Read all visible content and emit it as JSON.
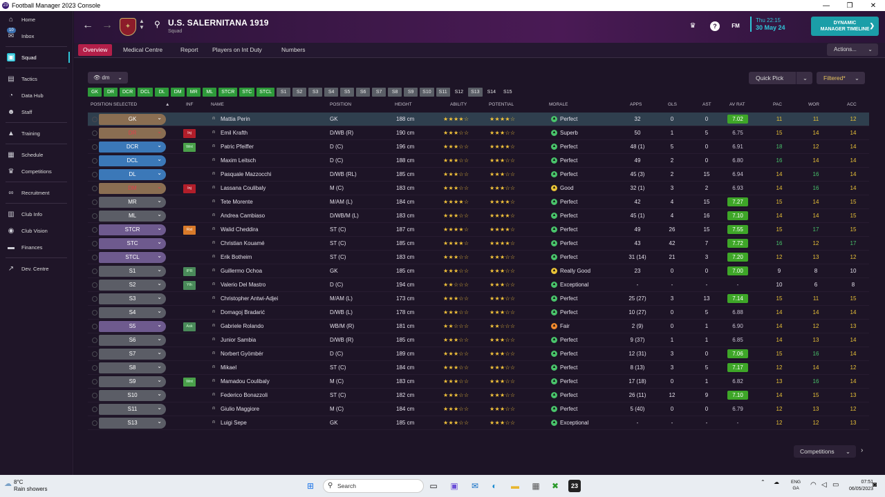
{
  "window": {
    "title": "Football Manager 2023 Console",
    "app_icon": "23"
  },
  "sidebar": {
    "items": [
      {
        "label": "Home",
        "icon": "house-icon",
        "glyph": "⌂"
      },
      {
        "label": "Inbox",
        "icon": "mail-icon",
        "glyph": "✉",
        "badge": "10"
      },
      {
        "label": "Squad",
        "icon": "shirt-icon",
        "glyph": "▣",
        "active": true
      },
      {
        "label": "Tactics",
        "icon": "clipboard-icon",
        "glyph": "▤"
      },
      {
        "label": "Data Hub",
        "icon": "chart-icon",
        "glyph": "◔"
      },
      {
        "label": "Staff",
        "icon": "people-icon",
        "glyph": "☻"
      },
      {
        "label": "Training",
        "icon": "cone-icon",
        "glyph": "▲"
      },
      {
        "label": "Schedule",
        "icon": "calendar-icon",
        "glyph": "▦"
      },
      {
        "label": "Competitions",
        "icon": "trophy-icon",
        "glyph": "♛"
      },
      {
        "label": "Recruitment",
        "icon": "binoculars-icon",
        "glyph": "∞"
      },
      {
        "label": "Club Info",
        "icon": "building-icon",
        "glyph": "▥"
      },
      {
        "label": "Club Vision",
        "icon": "eye-icon",
        "glyph": "◉"
      },
      {
        "label": "Finances",
        "icon": "money-icon",
        "glyph": "▬"
      },
      {
        "label": "Dev. Centre",
        "icon": "growth-icon",
        "glyph": "↗"
      }
    ]
  },
  "header": {
    "club_name": "U.S. SALERNITANA 1919",
    "subtitle": "Squad",
    "date_line1": "Thu 22:15",
    "date_line2": "30 May 24",
    "timeline_line1": "DYNAMIC",
    "timeline_line2": "MANAGER TIMELINE",
    "help": "?",
    "fm": "FM"
  },
  "tabs": [
    {
      "label": "Overview",
      "active": true
    },
    {
      "label": "Medical Centre"
    },
    {
      "label": "Report"
    },
    {
      "label": "Players on Int Duty"
    },
    {
      "label": "Numbers"
    }
  ],
  "toolbar": {
    "actions": "Actions...",
    "view": "dm",
    "quick_pick": "Quick Pick",
    "filtered": "Filtered*"
  },
  "position_chips": [
    {
      "label": "GK",
      "c": "green"
    },
    {
      "label": "DR",
      "c": "green"
    },
    {
      "label": "DCR",
      "c": "green"
    },
    {
      "label": "DCL",
      "c": "green"
    },
    {
      "label": "DL",
      "c": "green"
    },
    {
      "label": "DM",
      "c": "green"
    },
    {
      "label": "MR",
      "c": "green"
    },
    {
      "label": "ML",
      "c": "green"
    },
    {
      "label": "STCR",
      "c": "green"
    },
    {
      "label": "STC",
      "c": "green"
    },
    {
      "label": "STCL",
      "c": "green"
    },
    {
      "label": "S1",
      "c": "grey"
    },
    {
      "label": "S2",
      "c": "grey"
    },
    {
      "label": "S3",
      "c": "grey"
    },
    {
      "label": "S4",
      "c": "grey"
    },
    {
      "label": "S5",
      "c": "grey"
    },
    {
      "label": "S6",
      "c": "grey"
    },
    {
      "label": "S7",
      "c": "grey"
    },
    {
      "label": "S8",
      "c": "grey"
    },
    {
      "label": "S9",
      "c": "grey"
    },
    {
      "label": "S10",
      "c": "grey"
    },
    {
      "label": "S11",
      "c": "grey"
    },
    {
      "label": "S12",
      "c": "plain"
    },
    {
      "label": "S13",
      "c": "grey"
    },
    {
      "label": "S14",
      "c": "plain"
    },
    {
      "label": "S15",
      "c": "plain"
    }
  ],
  "columns": {
    "position_selected": "POSITION SELECTED",
    "inf": "INF",
    "name": "NAME",
    "position": "POSITION",
    "height": "HEIGHT",
    "ability": "ABILITY",
    "potential": "POTENTIAL",
    "morale": "MORALE",
    "apps": "APPS",
    "gls": "GLS",
    "ast": "AST",
    "avrat": "AV RAT",
    "pac": "PAC",
    "wor": "WOR",
    "acc": "ACC"
  },
  "players": [
    {
      "slot": "GK",
      "pc": "k",
      "inf": "",
      "name": "Mattia Perin",
      "position": "GK",
      "height": "188 cm",
      "ability": "★★★★☆",
      "potential": "★★★★☆",
      "morale": "Perfect",
      "mc": "gr",
      "apps": "32",
      "gls": "0",
      "ast": "0",
      "avrat": "7.02",
      "hi": true,
      "pac": "11",
      "wor": "11",
      "acc": "12",
      "pacc": "y",
      "worc": "y",
      "accc": "y"
    },
    {
      "slot": "DR",
      "pc": "k",
      "red": true,
      "inf": "Inj",
      "ic": "inj",
      "name": "Emil Krafth",
      "position": "D/WB (R)",
      "height": "190 cm",
      "ability": "★★★☆☆",
      "potential": "★★★☆☆",
      "morale": "Superb",
      "mc": "gr",
      "apps": "50",
      "gls": "1",
      "ast": "5",
      "avrat": "6.75",
      "hi": false,
      "pac": "15",
      "wor": "14",
      "acc": "14",
      "pacc": "y",
      "worc": "y",
      "accc": "y"
    },
    {
      "slot": "DCR",
      "pc": "b",
      "inf": "Wnt",
      "ic": "wnt",
      "name": "Patric Pfeiffer",
      "position": "D (C)",
      "height": "196 cm",
      "ability": "★★★☆☆",
      "potential": "★★★★☆",
      "morale": "Perfect",
      "mc": "gr",
      "apps": "48 (1)",
      "gls": "5",
      "ast": "0",
      "avrat": "6.91",
      "hi": false,
      "pac": "18",
      "wor": "12",
      "acc": "14",
      "pacc": "g",
      "worc": "y",
      "accc": "y"
    },
    {
      "slot": "DCL",
      "pc": "b",
      "inf": "",
      "name": "Maxim Leitsch",
      "position": "D (C)",
      "height": "188 cm",
      "ability": "★★★☆☆",
      "potential": "★★★☆☆",
      "morale": "Perfect",
      "mc": "gr",
      "apps": "49",
      "gls": "2",
      "ast": "0",
      "avrat": "6.80",
      "hi": false,
      "pac": "16",
      "wor": "14",
      "acc": "14",
      "pacc": "g",
      "worc": "y",
      "accc": "y"
    },
    {
      "slot": "DL",
      "pc": "b",
      "inf": "",
      "name": "Pasquale Mazzocchi",
      "position": "D/WB (RL)",
      "height": "185 cm",
      "ability": "★★★☆☆",
      "potential": "★★★☆☆",
      "morale": "Perfect",
      "mc": "gr",
      "apps": "45 (3)",
      "gls": "2",
      "ast": "15",
      "avrat": "6.94",
      "hi": false,
      "pac": "14",
      "wor": "16",
      "acc": "14",
      "pacc": "y",
      "worc": "g",
      "accc": "y"
    },
    {
      "slot": "DM",
      "pc": "k",
      "red": true,
      "inf": "Inj",
      "ic": "inj",
      "name": "Lassana Coulibaly",
      "position": "M (C)",
      "height": "183 cm",
      "ability": "★★★☆☆",
      "potential": "★★★☆☆",
      "morale": "Good",
      "mc": "ye",
      "apps": "32 (1)",
      "gls": "3",
      "ast": "2",
      "avrat": "6.93",
      "hi": false,
      "pac": "14",
      "wor": "16",
      "acc": "14",
      "pacc": "y",
      "worc": "g",
      "accc": "y"
    },
    {
      "slot": "MR",
      "pc": "g",
      "inf": "",
      "name": "Tete Morente",
      "position": "M/AM (L)",
      "height": "184 cm",
      "ability": "★★★★☆",
      "potential": "★★★★☆",
      "morale": "Perfect",
      "mc": "gr",
      "apps": "42",
      "gls": "4",
      "ast": "15",
      "avrat": "7.27",
      "hi": true,
      "pac": "15",
      "wor": "14",
      "acc": "15",
      "pacc": "y",
      "worc": "y",
      "accc": "y"
    },
    {
      "slot": "ML",
      "pc": "g",
      "inf": "",
      "name": "Andrea Cambiaso",
      "position": "D/WB/M (L)",
      "height": "183 cm",
      "ability": "★★★☆☆",
      "potential": "★★★★☆",
      "morale": "Perfect",
      "mc": "gr",
      "apps": "45 (1)",
      "gls": "4",
      "ast": "16",
      "avrat": "7.10",
      "hi": true,
      "pac": "14",
      "wor": "14",
      "acc": "15",
      "pacc": "y",
      "worc": "y",
      "accc": "y"
    },
    {
      "slot": "STCR",
      "pc": "p",
      "inf": "Rst",
      "ic": "rst",
      "name": "Walid Cheddira",
      "position": "ST (C)",
      "height": "187 cm",
      "ability": "★★★★☆",
      "potential": "★★★★☆",
      "morale": "Perfect",
      "mc": "gr",
      "apps": "49",
      "gls": "26",
      "ast": "15",
      "avrat": "7.55",
      "hi": true,
      "pac": "15",
      "wor": "17",
      "acc": "15",
      "pacc": "y",
      "worc": "g",
      "accc": "y"
    },
    {
      "slot": "STC",
      "pc": "p",
      "inf": "",
      "name": "Christian Kouamé",
      "position": "ST (C)",
      "height": "185 cm",
      "ability": "★★★★☆",
      "potential": "★★★★☆",
      "morale": "Perfect",
      "mc": "gr",
      "apps": "43",
      "gls": "42",
      "ast": "7",
      "avrat": "7.72",
      "hi": true,
      "pac": "16",
      "wor": "12",
      "acc": "17",
      "pacc": "g",
      "worc": "y",
      "accc": "g"
    },
    {
      "slot": "STCL",
      "pc": "p",
      "inf": "",
      "name": "Erik Botheim",
      "position": "ST (C)",
      "height": "183 cm",
      "ability": "★★★☆☆",
      "potential": "★★★☆☆",
      "morale": "Perfect",
      "mc": "gr",
      "apps": "31 (14)",
      "gls": "21",
      "ast": "3",
      "avrat": "7.20",
      "hi": true,
      "pac": "12",
      "wor": "13",
      "acc": "12",
      "pacc": "y",
      "worc": "y",
      "accc": "y"
    },
    {
      "slot": "S1",
      "pc": "g",
      "inf": "IPR",
      "ic": "ipr",
      "name": "Guillermo Ochoa",
      "position": "GK",
      "height": "185 cm",
      "ability": "★★★☆☆",
      "potential": "★★★☆☆",
      "morale": "Really Good",
      "mc": "ye",
      "apps": "23",
      "gls": "0",
      "ast": "0",
      "avrat": "7.00",
      "hi": true,
      "pac": "9",
      "wor": "8",
      "acc": "10",
      "pacc": "w",
      "worc": "w",
      "accc": "w"
    },
    {
      "slot": "S2",
      "pc": "g",
      "inf": "Yth",
      "ic": "yth",
      "name": "Valerio Del Mastro",
      "position": "D (C)",
      "height": "194 cm",
      "ability": "★★☆☆☆",
      "potential": "★★★☆☆",
      "morale": "Exceptional",
      "mc": "gr",
      "apps": "-",
      "gls": "-",
      "ast": "-",
      "avrat": "-",
      "hi": false,
      "pac": "10",
      "wor": "6",
      "acc": "8",
      "pacc": "w",
      "worc": "w",
      "accc": "w"
    },
    {
      "slot": "S3",
      "pc": "g",
      "inf": "",
      "name": "Christopher Antwi-Adjei",
      "position": "M/AM (L)",
      "height": "173 cm",
      "ability": "★★★☆☆",
      "potential": "★★★☆☆",
      "morale": "Perfect",
      "mc": "gr",
      "apps": "25 (27)",
      "gls": "3",
      "ast": "13",
      "avrat": "7.14",
      "hi": true,
      "pac": "15",
      "wor": "11",
      "acc": "15",
      "pacc": "y",
      "worc": "y",
      "accc": "y"
    },
    {
      "slot": "S4",
      "pc": "g",
      "inf": "",
      "name": "Domagoj Bradarić",
      "position": "D/WB (L)",
      "height": "178 cm",
      "ability": "★★★☆☆",
      "potential": "★★★☆☆",
      "morale": "Perfect",
      "mc": "gr",
      "apps": "10 (27)",
      "gls": "0",
      "ast": "5",
      "avrat": "6.88",
      "hi": false,
      "pac": "14",
      "wor": "14",
      "acc": "14",
      "pacc": "y",
      "worc": "y",
      "accc": "y"
    },
    {
      "slot": "S5",
      "pc": "p",
      "inf": "Ask",
      "ic": "ask",
      "name": "Gabriele Rolando",
      "position": "WB/M (R)",
      "height": "181 cm",
      "ability": "★★☆☆☆",
      "potential": "★★☆☆☆",
      "morale": "Fair",
      "mc": "or",
      "apps": "2 (9)",
      "gls": "0",
      "ast": "1",
      "avrat": "6.90",
      "hi": false,
      "pac": "14",
      "wor": "12",
      "acc": "13",
      "pacc": "y",
      "worc": "y",
      "accc": "y"
    },
    {
      "slot": "S6",
      "pc": "g",
      "inf": "",
      "name": "Junior Sambia",
      "position": "D/WB (R)",
      "height": "185 cm",
      "ability": "★★★☆☆",
      "potential": "★★★☆☆",
      "morale": "Perfect",
      "mc": "gr",
      "apps": "9 (37)",
      "gls": "1",
      "ast": "1",
      "avrat": "6.85",
      "hi": false,
      "pac": "14",
      "wor": "13",
      "acc": "14",
      "pacc": "y",
      "worc": "y",
      "accc": "y"
    },
    {
      "slot": "S7",
      "pc": "g",
      "inf": "",
      "name": "Norbert Gyömbér",
      "position": "D (C)",
      "height": "189 cm",
      "ability": "★★★☆☆",
      "potential": "★★★☆☆",
      "morale": "Perfect",
      "mc": "gr",
      "apps": "12 (31)",
      "gls": "3",
      "ast": "0",
      "avrat": "7.06",
      "hi": true,
      "pac": "15",
      "wor": "16",
      "acc": "14",
      "pacc": "y",
      "worc": "g",
      "accc": "y"
    },
    {
      "slot": "S8",
      "pc": "g",
      "inf": "",
      "name": "Mikael",
      "position": "ST (C)",
      "height": "184 cm",
      "ability": "★★★☆☆",
      "potential": "★★★☆☆",
      "morale": "Perfect",
      "mc": "gr",
      "apps": "8 (13)",
      "gls": "3",
      "ast": "5",
      "avrat": "7.17",
      "hi": true,
      "pac": "12",
      "wor": "14",
      "acc": "12",
      "pacc": "y",
      "worc": "y",
      "accc": "y"
    },
    {
      "slot": "S9",
      "pc": "g",
      "inf": "Wnt",
      "ic": "wnt",
      "name": "Mamadou Coulibaly",
      "position": "M (C)",
      "height": "183 cm",
      "ability": "★★★☆☆",
      "potential": "★★★☆☆",
      "morale": "Perfect",
      "mc": "gr",
      "apps": "17 (18)",
      "gls": "0",
      "ast": "1",
      "avrat": "6.82",
      "hi": false,
      "pac": "13",
      "wor": "16",
      "acc": "14",
      "pacc": "y",
      "worc": "g",
      "accc": "y"
    },
    {
      "slot": "S10",
      "pc": "g",
      "inf": "",
      "name": "Federico Bonazzoli",
      "position": "ST (C)",
      "height": "182 cm",
      "ability": "★★★☆☆",
      "potential": "★★★☆☆",
      "morale": "Perfect",
      "mc": "gr",
      "apps": "26 (11)",
      "gls": "12",
      "ast": "9",
      "avrat": "7.10",
      "hi": true,
      "pac": "14",
      "wor": "15",
      "acc": "13",
      "pacc": "y",
      "worc": "y",
      "accc": "y"
    },
    {
      "slot": "S11",
      "pc": "g",
      "inf": "",
      "name": "Giulio Maggiore",
      "position": "M (C)",
      "height": "184 cm",
      "ability": "★★★☆☆",
      "potential": "★★★☆☆",
      "morale": "Perfect",
      "mc": "gr",
      "apps": "5 (40)",
      "gls": "0",
      "ast": "0",
      "avrat": "6.79",
      "hi": false,
      "pac": "12",
      "wor": "13",
      "acc": "12",
      "pacc": "y",
      "worc": "y",
      "accc": "y"
    },
    {
      "slot": "S13",
      "pc": "g",
      "inf": "",
      "name": "Luigi Sepe",
      "position": "GK",
      "height": "185 cm",
      "ability": "★★★☆☆",
      "potential": "★★★☆☆",
      "morale": "Exceptional",
      "mc": "gr",
      "apps": "-",
      "gls": "-",
      "ast": "-",
      "avrat": "-",
      "hi": false,
      "pac": "12",
      "wor": "12",
      "acc": "13",
      "pacc": "y",
      "worc": "y",
      "accc": "y"
    }
  ],
  "footer": {
    "competitions": "Competitions"
  },
  "taskbar": {
    "temp": "8°C",
    "weather": "Rain showers",
    "search": "Search",
    "lang1": "ENG",
    "lang2": "GA",
    "time": "07:51",
    "date": "06/05/2023"
  }
}
